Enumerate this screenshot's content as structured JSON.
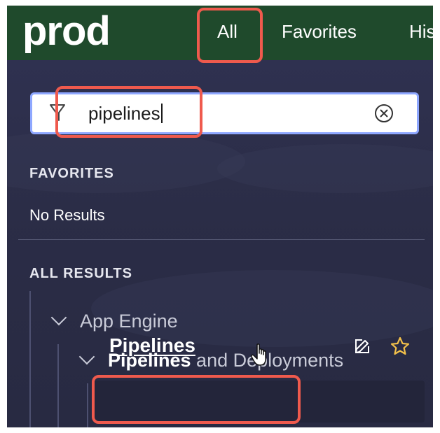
{
  "header": {
    "brand": "prod",
    "tabs": [
      {
        "label": "All"
      },
      {
        "label": "Favorites"
      },
      {
        "label": "His"
      }
    ]
  },
  "search": {
    "value": "pipelines",
    "filter_icon": "filter-icon",
    "clear_icon": "clear-circle-x-icon"
  },
  "favorites": {
    "heading": "FAVORITES",
    "empty_text": "No Results"
  },
  "results": {
    "heading": "ALL RESULTS",
    "tree": {
      "level1": "App Engine",
      "level2_bold": "Pipelines",
      "level2_rest": " and Deployments",
      "level3": "Pipelines"
    },
    "row_icons": [
      "edit-icon",
      "star-icon"
    ]
  },
  "colors": {
    "header_bg": "#1f4a2c",
    "panel_bg": "#2b2d45",
    "highlight": "#ef5a4d",
    "search_border": "#8ea7ff",
    "star": "#f2c04a"
  }
}
